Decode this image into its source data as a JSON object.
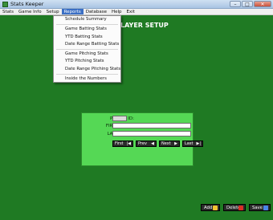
{
  "window": {
    "title": "Stats Keeper",
    "min": "–",
    "max": "□",
    "close": "✕"
  },
  "menu": {
    "items": [
      "Stats",
      "Game Info",
      "Setup",
      "Reports",
      "Database",
      "Help",
      "Exit"
    ],
    "active": "Reports"
  },
  "reports_menu": {
    "items": [
      "Schedule Summary",
      "Game Batting Stats",
      "YTD Batting Stats",
      "Date Range Batting Stats",
      "Game Pitching Stats",
      "YTD Pitching Stats",
      "Date Range Pitching Stats",
      "Inside the Numbers"
    ]
  },
  "page": {
    "heading": "LAYER SETUP"
  },
  "form": {
    "player_id_label": "PLAYER ID:",
    "first_name_label": "FIRST NAME:",
    "last_name_label": "LAST NAME:",
    "player_id_value": "",
    "first_name_value": "",
    "last_name_value": ""
  },
  "nav": {
    "first": "First",
    "prev": "Prev",
    "next": "Next",
    "last": "Last",
    "first_icon": "|◀",
    "prev_icon": "◀",
    "next_icon": "▶",
    "last_icon": "▶|"
  },
  "actions": {
    "add": "Add",
    "delete": "Delete",
    "save": "Save"
  },
  "colors": {
    "background": "#1f7a23",
    "panel": "#55d855",
    "menu_highlight": "#3b6fc4"
  }
}
